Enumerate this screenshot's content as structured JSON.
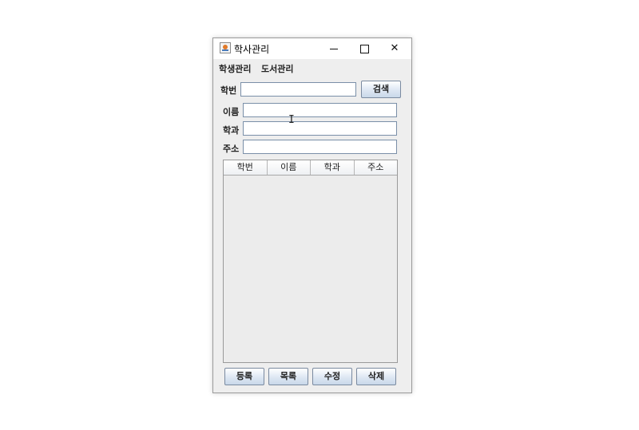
{
  "window": {
    "title": "학사관리",
    "controls": {
      "minimize": "minimize",
      "maximize": "maximize",
      "close": "✕"
    }
  },
  "menu": [
    "학생관리",
    "도서관리"
  ],
  "form": {
    "fields": [
      {
        "label": "학번",
        "value": ""
      },
      {
        "label": "이름",
        "value": ""
      },
      {
        "label": "학과",
        "value": ""
      },
      {
        "label": "주소",
        "value": ""
      }
    ],
    "search_button": "검색"
  },
  "table": {
    "columns": [
      "학번",
      "이름",
      "학과",
      "주소"
    ],
    "rows": []
  },
  "buttons": [
    "등록",
    "목록",
    "수정",
    "삭제"
  ],
  "colors": {
    "window_bg": "#eeeeee",
    "field_border": "#7a8fa8",
    "button_gradient_end": "#c9d8ea"
  }
}
